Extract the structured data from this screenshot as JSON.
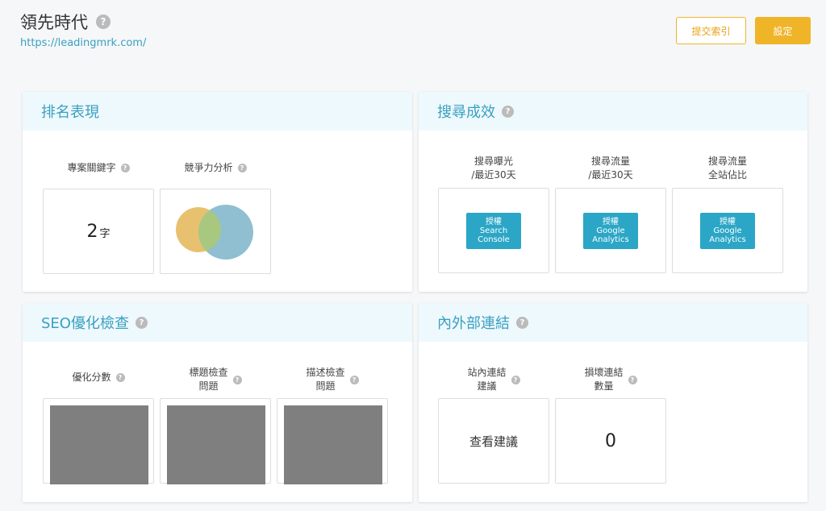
{
  "header": {
    "title": "領先時代",
    "url": "https://leadingmrk.com/",
    "submit_index_label": "提交索引",
    "settings_label": "設定"
  },
  "ranking": {
    "title": "排名表現",
    "keywords_label": "專案關鍵字",
    "keywords_value": "2",
    "keywords_unit": "字",
    "competition_label": "競爭力分析"
  },
  "search": {
    "title": "搜尋成效",
    "items": [
      {
        "label_line1": "搜尋曝光",
        "label_line2": "/最近30天",
        "button": [
          "授權",
          "Search",
          "Console"
        ]
      },
      {
        "label_line1": "搜尋流量",
        "label_line2": "/最近30天",
        "button": [
          "授權",
          "Google",
          "Analytics"
        ]
      },
      {
        "label_line1": "搜尋流量",
        "label_line2": "全站佔比",
        "button": [
          "授權",
          "Google",
          "Analytics"
        ]
      }
    ]
  },
  "seo": {
    "title": "SEO優化檢查",
    "score_label": "優化分數",
    "title_check_line1": "標題檢查",
    "title_check_line2": "問題",
    "desc_check_line1": "描述檢查",
    "desc_check_line2": "問題"
  },
  "links": {
    "title": "內外部連結",
    "internal_line1": "站內連結",
    "internal_line2": "建議",
    "internal_value": "查看建議",
    "broken_line1": "損壞連結",
    "broken_line2": "數量",
    "broken_value": "0"
  },
  "colors": {
    "accent": "#3aa0c0",
    "button_yellow": "#f0b429",
    "auth_button": "#2ba6c6",
    "venn_left": "#e8c170",
    "venn_right": "#8fbfd0",
    "venn_overlap": "#a8c87f"
  },
  "icons": {
    "help": "question-mark-circle-icon"
  }
}
